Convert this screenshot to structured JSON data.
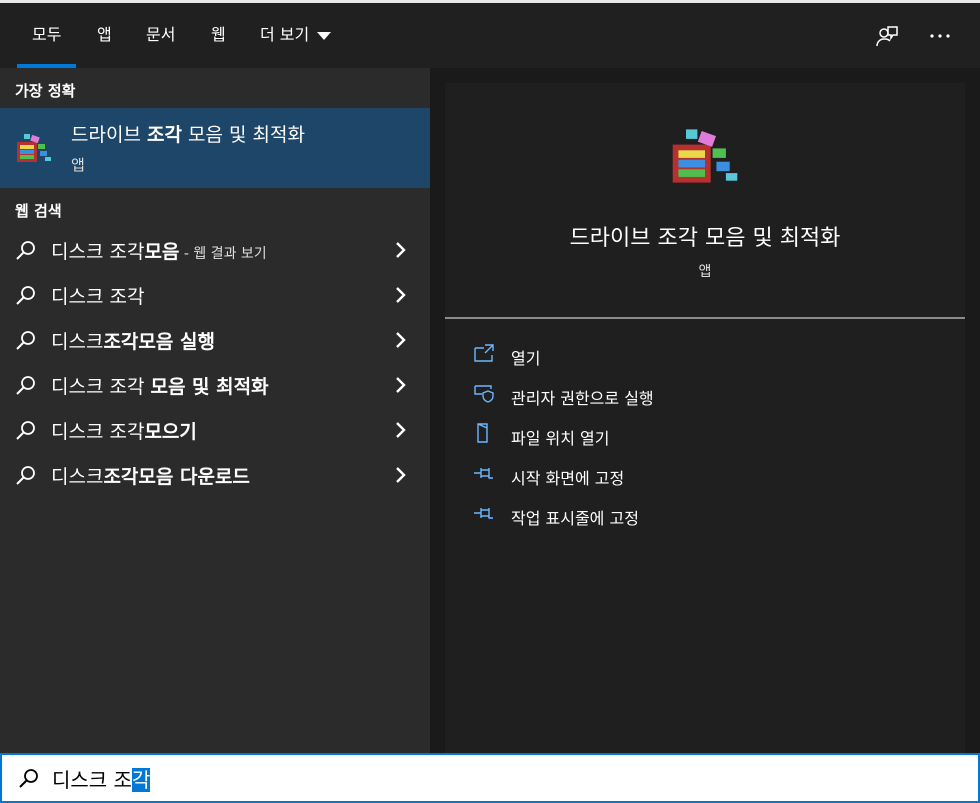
{
  "tabs": [
    {
      "label": "모두"
    },
    {
      "label": "앱"
    },
    {
      "label": "문서"
    },
    {
      "label": "웹"
    },
    {
      "label": "더 보기"
    }
  ],
  "icons": {
    "feedback": "feedback-icon",
    "more": "more-options-icon",
    "search": "search-icon",
    "chevron": "chevron-right-icon"
  },
  "best_match": {
    "section_label": "가장 정확",
    "title_pre": "드라이브 ",
    "title_bold": "조각",
    "title_post": " 모음 및 최적화",
    "subtitle": "앱"
  },
  "web_search": {
    "section_label": "웹 검색",
    "items": [
      {
        "normal": "디스크 조각",
        "bold": "모음",
        "hint": " - 웹 결과 보기"
      },
      {
        "normal": "디스크 조각",
        "bold": "",
        "hint": ""
      },
      {
        "normal": "디스크",
        "bold": "조각모음 실행",
        "hint": ""
      },
      {
        "normal": "디스크 조각 ",
        "bold": "모음 및 최적화",
        "hint": ""
      },
      {
        "normal": "디스크 조각",
        "bold": "모으기",
        "hint": ""
      },
      {
        "normal": "디스크",
        "bold": "조각모음 다운로드",
        "hint": ""
      }
    ]
  },
  "detail": {
    "title": "드라이브 조각 모음 및 최적화",
    "subtitle": "앱",
    "actions": [
      {
        "label": "열기",
        "icon": "open-icon"
      },
      {
        "label": "관리자 권한으로 실행",
        "icon": "shield-icon"
      },
      {
        "label": "파일 위치 열기",
        "icon": "file-location-icon"
      },
      {
        "label": "시작 화면에 고정",
        "icon": "pin-icon"
      },
      {
        "label": "작업 표시줄에 고정",
        "icon": "pin-icon"
      }
    ]
  },
  "search": {
    "typed": "디스크 조",
    "selected": "각"
  },
  "colors": {
    "accent": "#0078d7",
    "selection": "#1d4669",
    "icon_blue": "#6cb7ff"
  }
}
